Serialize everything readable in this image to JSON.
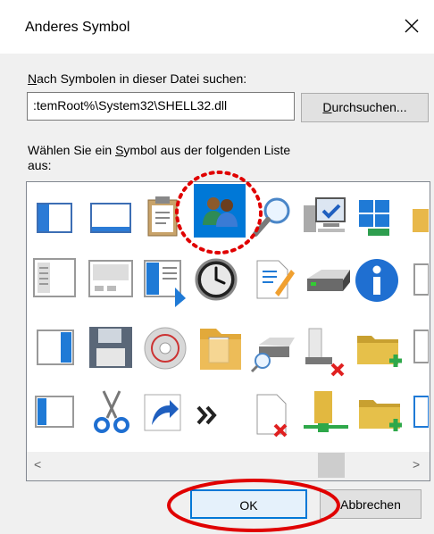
{
  "dialog": {
    "title": "Anderes Symbol",
    "search_label_pre": "",
    "search_label_ul": "N",
    "search_label_post": "ach Symbolen in dieser Datei suchen:",
    "file_path": ":temRoot%\\System32\\SHELL32.dll",
    "browse_ul": "D",
    "browse_post": "urchsuchen...",
    "choose_line1_pre": "Wählen Sie ein ",
    "choose_line1_ul": "S",
    "choose_line1_post": "ymbol aus der folgenden Liste",
    "choose_line2": "aus:",
    "ok_label": "OK",
    "cancel_label": "Abbrechen",
    "scroll_left": "<",
    "scroll_right": ">"
  },
  "icons": [
    "window-left-pane-icon",
    "window-blank-icon",
    "clipboard-icon",
    "users-icon",
    "magnifier-icon",
    "monitor-network-icon",
    "windows-logo-icon",
    "folder-partial-icon",
    "window-columns-icon",
    "window-details-icon",
    "window-arrow-icon",
    "clock-icon",
    "document-edit-icon",
    "drive-icon",
    "info-icon",
    "window-partial-icon",
    "window-blue-sidebar-icon",
    "floppy-icon",
    "cd-icon",
    "folder-documents-icon",
    "network-drive-search-icon",
    "network-drive-disconnected-icon",
    "folder-add-icon",
    "window-partial-icon",
    "window-sidebar-icon",
    "scissors-icon",
    "shortcut-arrow-icon",
    "double-chevron-icon",
    "document-delete-icon",
    "folder-network-icon",
    "folder-add-icon",
    "window-partial-icon"
  ],
  "colors": {
    "selection": "#0078d7",
    "annotation": "#e00000"
  }
}
